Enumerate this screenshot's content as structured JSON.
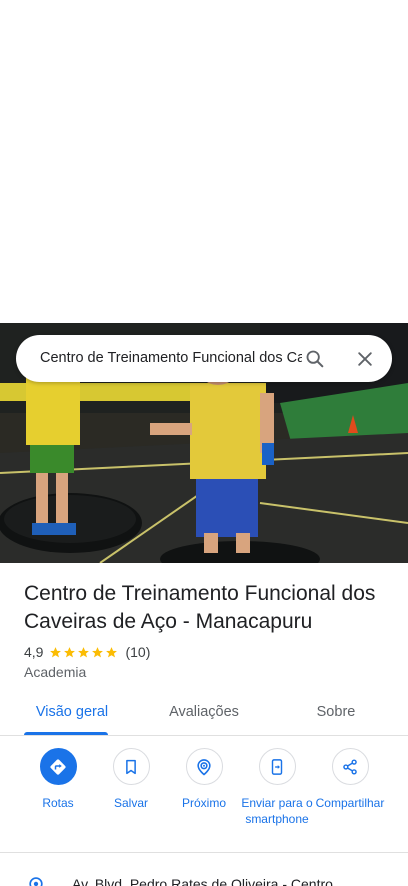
{
  "search": {
    "query": "Centro de Treinamento Funcional dos Caveiras de Aço - Manacapuru"
  },
  "place": {
    "title": "Centro de Treinamento Funcional dos Caveiras de Aço - Manacapuru",
    "rating": "4,9",
    "rating_stars": 5,
    "review_count": "(10)",
    "category": "Academia"
  },
  "tabs": [
    {
      "label": "Visão geral",
      "active": true
    },
    {
      "label": "Avaliações",
      "active": false
    },
    {
      "label": "Sobre",
      "active": false
    }
  ],
  "actions": [
    {
      "label": "Rotas",
      "icon": "directions-icon"
    },
    {
      "label": "Salvar",
      "icon": "bookmark-icon"
    },
    {
      "label": "Próximo",
      "icon": "nearby-icon"
    },
    {
      "label": "Enviar para o smartphone",
      "icon": "send-to-phone-icon"
    },
    {
      "label": "Compartilhar",
      "icon": "share-icon"
    }
  ],
  "address": {
    "text": "Av. Blvd. Pedro Rates de Oliveira - Centro"
  },
  "colors": {
    "accent": "#1a73e8",
    "star": "#fbbc04"
  }
}
